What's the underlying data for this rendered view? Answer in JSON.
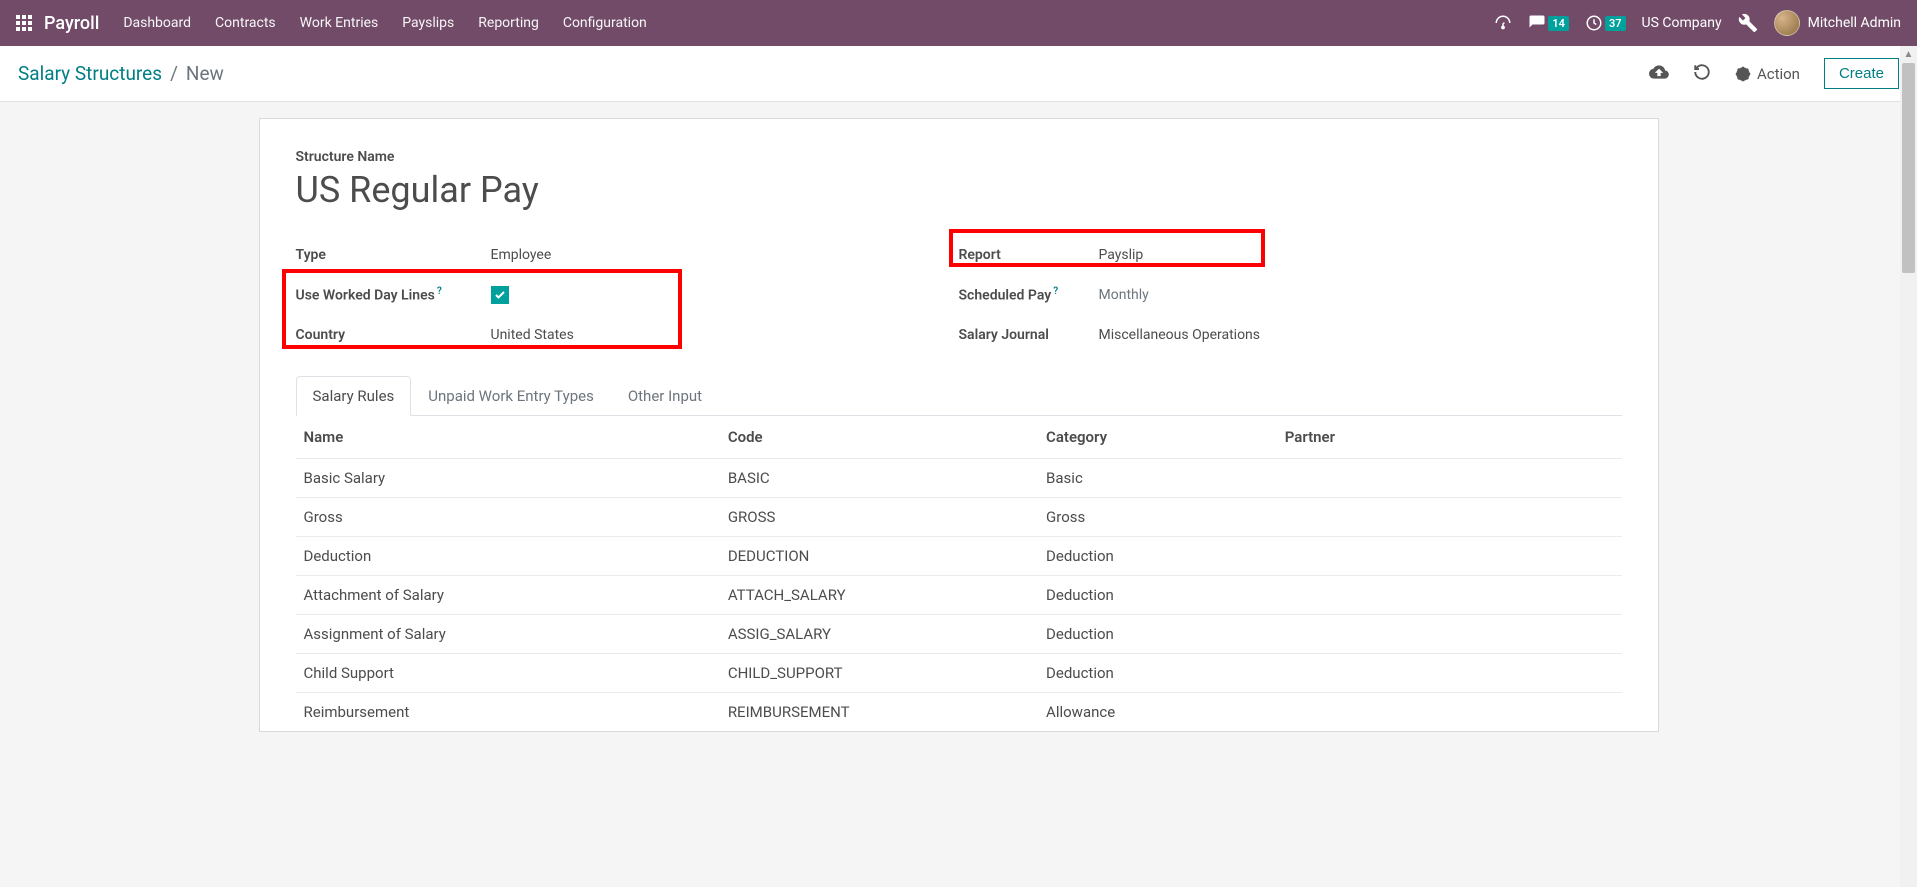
{
  "header": {
    "brand": "Payroll",
    "nav": [
      "Dashboard",
      "Contracts",
      "Work Entries",
      "Payslips",
      "Reporting",
      "Configuration"
    ],
    "messages_count": "14",
    "activities_count": "37",
    "company": "US Company",
    "username": "Mitchell Admin"
  },
  "breadcrumb": {
    "parent": "Salary Structures",
    "current": "New"
  },
  "toolbar": {
    "action_label": "Action",
    "create_label": "Create"
  },
  "form": {
    "structure_name_label": "Structure Name",
    "structure_name_value": "US Regular Pay",
    "left": {
      "type_label": "Type",
      "type_value": "Employee",
      "uwdl_label": "Use Worked Day Lines",
      "uwdl_checked": true,
      "country_label": "Country",
      "country_value": "United States"
    },
    "right": {
      "report_label": "Report",
      "report_value": "Payslip",
      "sched_label": "Scheduled Pay",
      "sched_value": "Monthly",
      "journal_label": "Salary Journal",
      "journal_value": "Miscellaneous Operations"
    }
  },
  "tabs": [
    "Salary Rules",
    "Unpaid Work Entry Types",
    "Other Input"
  ],
  "rules": {
    "headers": {
      "name": "Name",
      "code": "Code",
      "category": "Category",
      "partner": "Partner"
    },
    "rows": [
      {
        "name": "Basic Salary",
        "code": "BASIC",
        "category": "Basic",
        "partner": ""
      },
      {
        "name": "Gross",
        "code": "GROSS",
        "category": "Gross",
        "partner": ""
      },
      {
        "name": "Deduction",
        "code": "DEDUCTION",
        "category": "Deduction",
        "partner": ""
      },
      {
        "name": "Attachment of Salary",
        "code": "ATTACH_SALARY",
        "category": "Deduction",
        "partner": ""
      },
      {
        "name": "Assignment of Salary",
        "code": "ASSIG_SALARY",
        "category": "Deduction",
        "partner": ""
      },
      {
        "name": "Child Support",
        "code": "CHILD_SUPPORT",
        "category": "Deduction",
        "partner": ""
      },
      {
        "name": "Reimbursement",
        "code": "REIMBURSEMENT",
        "category": "Allowance",
        "partner": ""
      }
    ]
  }
}
